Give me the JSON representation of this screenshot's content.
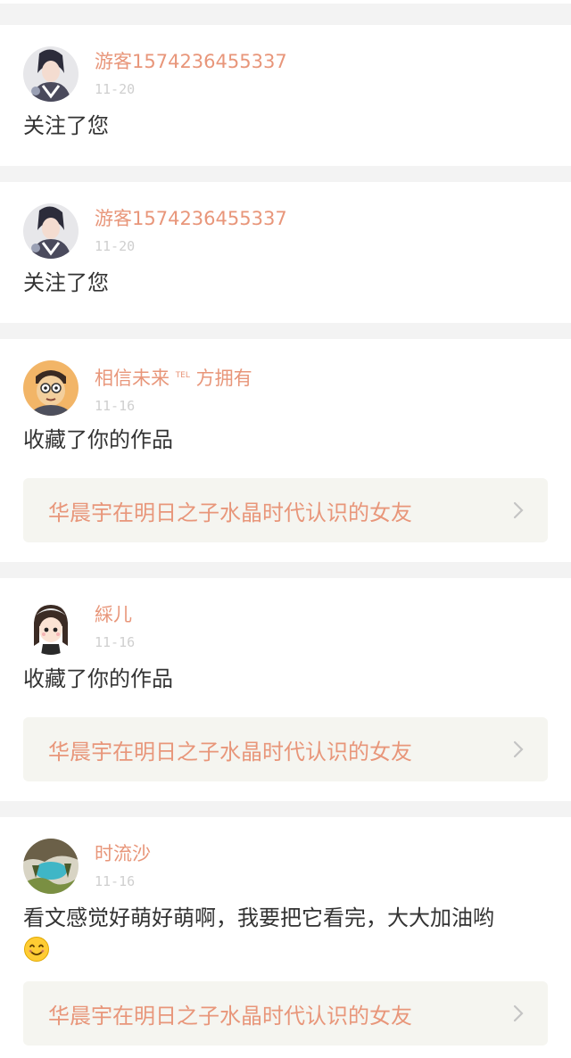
{
  "feed": {
    "items": [
      {
        "user": "游客1574236455337",
        "date": "11-20",
        "action": "关注了您",
        "avatar_icon": "anime-boy-avatar-icon"
      },
      {
        "user": "游客1574236455337",
        "date": "11-20",
        "action": "关注了您",
        "avatar_icon": "anime-boy-avatar-icon"
      },
      {
        "user": "相信未来",
        "user_tag": "TEL",
        "user_suffix": "方拥有",
        "date": "11-16",
        "action": "收藏了你的作品",
        "work_title": "华晨宇在明日之子水晶时代认识的女友",
        "avatar_icon": "cartoon-face-avatar-icon"
      },
      {
        "user": "綵儿",
        "date": "11-16",
        "action": "收藏了你的作品",
        "work_title": "华晨宇在明日之子水晶时代认识的女友",
        "avatar_icon": "chibi-girl-avatar-icon"
      },
      {
        "user": "时流沙",
        "date": "11-16",
        "action": "看文感觉好萌好萌啊，我要把它看完，大大加油哟",
        "emoji": "smile-emoji-icon",
        "work_title": "华晨宇在明日之子水晶时代认识的女友",
        "avatar_icon": "landscape-avatar-icon"
      }
    ]
  },
  "colors": {
    "accent": "#e8967a",
    "text": "#333333",
    "muted": "#cfcfcf",
    "background": "#f3f3f3",
    "ref_background": "#f5f5f0"
  }
}
